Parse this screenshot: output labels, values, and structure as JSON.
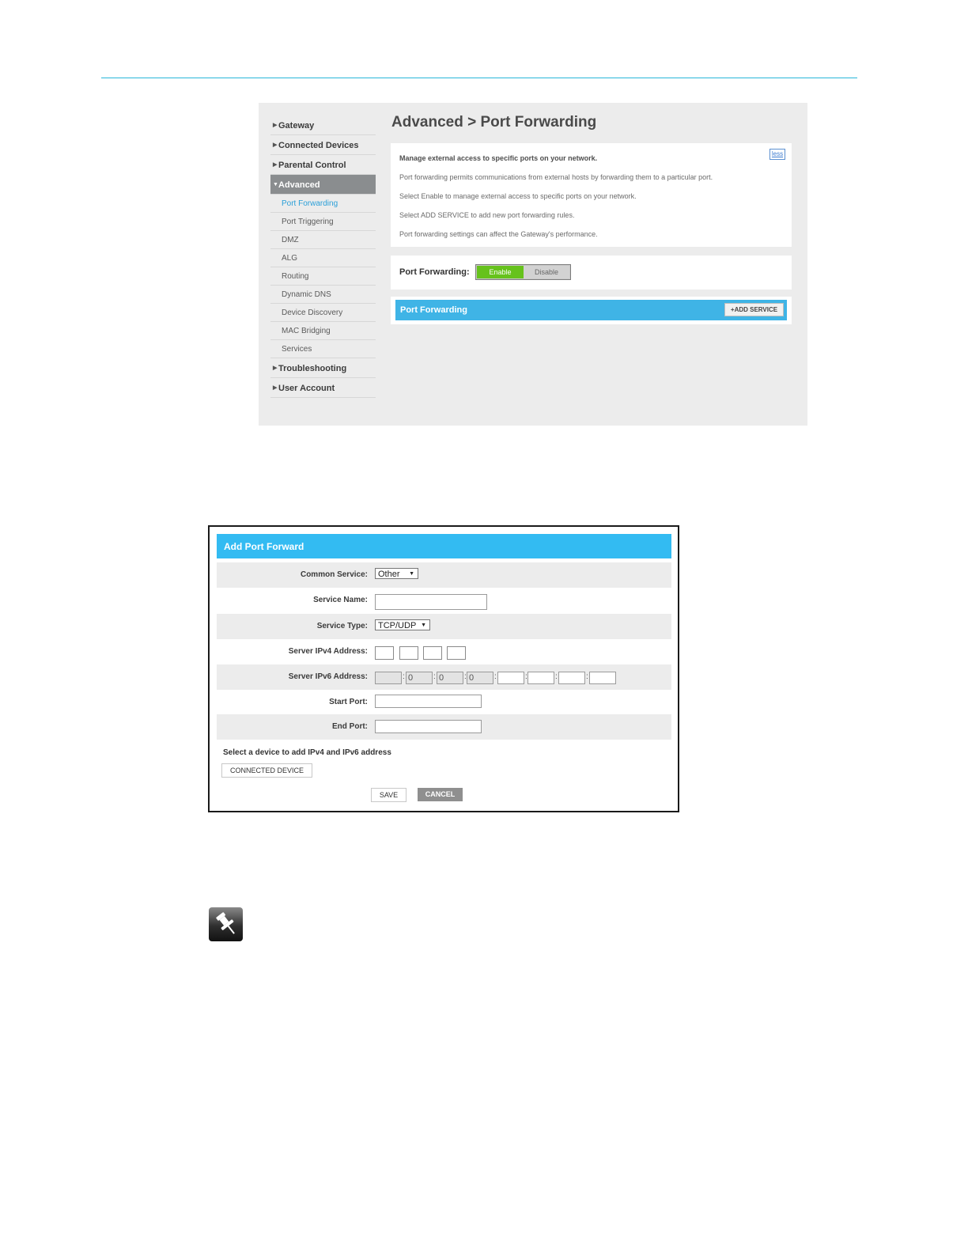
{
  "sidebar": {
    "top_items": [
      {
        "label": "Gateway"
      },
      {
        "label": "Connected Devices"
      },
      {
        "label": "Parental Control"
      },
      {
        "label": "Advanced"
      }
    ],
    "sub_items": [
      {
        "label": "Port Forwarding"
      },
      {
        "label": "Port Triggering"
      },
      {
        "label": "DMZ"
      },
      {
        "label": "ALG"
      },
      {
        "label": "Routing"
      },
      {
        "label": "Dynamic DNS"
      },
      {
        "label": "Device Discovery"
      },
      {
        "label": "MAC Bridging"
      },
      {
        "label": "Services"
      }
    ],
    "bottom_items": [
      {
        "label": "Troubleshooting"
      },
      {
        "label": "User Account"
      }
    ]
  },
  "main": {
    "title": "Advanced > Port Forwarding",
    "info": {
      "lines": [
        "Manage external access to specific ports on your network.",
        "Port forwarding permits communications from external hosts by forwarding them to a particular port.",
        "Select Enable to manage external access to specific ports on your network.",
        "Select ADD SERVICE to add new port forwarding rules.",
        "Port forwarding settings can affect the Gateway's performance."
      ],
      "less_link": "less"
    },
    "toggle": {
      "label": "Port Forwarding:",
      "enable": "Enable",
      "disable": "Disable",
      "state": "Enable"
    },
    "table": {
      "title": "Port Forwarding",
      "add_button": "+ADD SERVICE"
    }
  },
  "dialog": {
    "title": "Add Port Forward",
    "fields": {
      "common_service": {
        "label": "Common Service:",
        "value": "Other"
      },
      "service_name": {
        "label": "Service Name:",
        "value": ""
      },
      "service_type": {
        "label": "Service Type:",
        "value": "TCP/UDP"
      },
      "ipv4": {
        "label": "Server IPv4 Address:",
        "octets": [
          "",
          "",
          "",
          ""
        ]
      },
      "ipv6": {
        "label": "Server IPv6 Address:",
        "groups": [
          "",
          "0",
          "0",
          "0",
          "",
          "",
          "",
          ""
        ]
      },
      "start_port": {
        "label": "Start Port:",
        "value": ""
      },
      "end_port": {
        "label": "End Port:",
        "value": ""
      }
    },
    "device_note": "Select a device to add IPv4 and IPv6 address",
    "connected_device_button": "CONNECTED DEVICE",
    "save_button": "SAVE",
    "cancel_button": "CANCEL"
  },
  "colors": {
    "accent_rule": "#29b6d9",
    "header_blue": "#33bbf2",
    "enable_green": "#66c21c",
    "active_nav": "#8a8d8f",
    "link_blue": "#2a9fd8"
  },
  "icons": {
    "note": "pushpin-note-icon"
  }
}
